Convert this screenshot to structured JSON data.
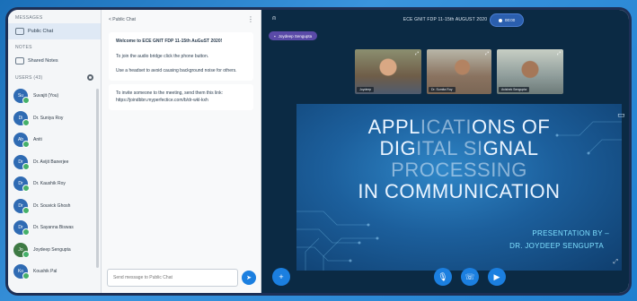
{
  "sidebar": {
    "messages_header": "MESSAGES",
    "public_chat_label": "Public Chat",
    "notes_header": "NOTES",
    "shared_notes_label": "Shared Notes",
    "users_header": "USERS (43)",
    "users": [
      {
        "initials": "Su",
        "name": "Suvajit (You)"
      },
      {
        "initials": "Di",
        "name": "Dr. Suniya Roy"
      },
      {
        "initials": "Ab",
        "name": "Aniti"
      },
      {
        "initials": "Dr",
        "name": "Dr. Avijit Banerjee"
      },
      {
        "initials": "Dr",
        "name": "Dr. Kaushik Roy"
      },
      {
        "initials": "Dr",
        "name": "Dr. Souvick Ghosh"
      },
      {
        "initials": "Dr",
        "name": "Dr. Sayanna Biswas"
      },
      {
        "initials": "Jo",
        "name": "Joydeep Sengupta"
      },
      {
        "initials": "Ko",
        "name": "Koushik Pal"
      }
    ]
  },
  "chat": {
    "back_label": "< Public Chat",
    "welcome_title": "Welcome to ECE GNIT FDP 11-15th AuGuST 2020!",
    "audio_bridge_text": "To join the audio bridge click the phone button.",
    "headset_text": "Use a headset to avoid causing background noise for others.",
    "invite_text": "To invite someone to the meeting, send them this link: https://joindbbn.myperfectice.com/b/dr-wkl-kxh",
    "input_placeholder": "Send message to Public Chat"
  },
  "meeting": {
    "title": "ECE GNIT FDP 11-15th AUGUST 2020",
    "record_label": "00:00",
    "presenter_label": "Joydeep Sengupta",
    "cams": [
      {
        "label": "Joydeep"
      },
      {
        "label": "Dr. Sumita Roy"
      },
      {
        "label": "Avishek Sengupta"
      }
    ]
  },
  "slide": {
    "title_line1a": "APPL",
    "title_line1b": "ICATI",
    "title_line1c": "ONS OF",
    "title_line2a": "DIG",
    "title_line2b": "ITAL SI",
    "title_line2c": "GNAL",
    "title_line3": "PROCESSING",
    "title_line4": "IN COMMUNICATION",
    "presentation_by": "PRESENTATION BY –",
    "presenter_name": "DR. JOYDEEP SENGUPTA"
  }
}
